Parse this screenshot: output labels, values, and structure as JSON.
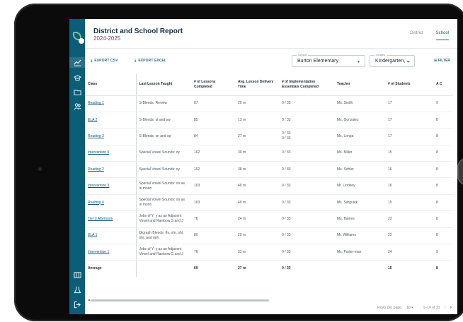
{
  "header": {
    "title": "District and School Report",
    "subtitle": "2024-2025",
    "tabs": [
      {
        "label": "District",
        "active": false
      },
      {
        "label": "School",
        "active": true
      }
    ]
  },
  "toolbar": {
    "export_csv": "EXPORT CSV",
    "export_excel": "EXPORT EXCEL",
    "school": {
      "label": "School",
      "value": "Burton Elementary"
    },
    "grades": {
      "label": "Grades",
      "value": "Kindergarten, ..."
    },
    "filter": "FILTER"
  },
  "table": {
    "columns": [
      "Class",
      "Last Lesson Taught",
      "# of Lessons Completed",
      "Avg. Lesson Delivery Time",
      "# of Implementation Essentials Completed",
      "Teacher",
      "# of Students",
      "A C"
    ],
    "rows": [
      [
        "Reading 1",
        "S-Blends: Review",
        "87",
        "20 m",
        "0 / 33",
        "Ms. Smith",
        "17",
        "9"
      ],
      [
        "ELA 2",
        "S-Blends: st and sw",
        "85",
        "13 m",
        "0 / 33",
        "Ms. Gonzalez",
        "17",
        "8"
      ],
      [
        "Reading 3",
        "S-Blends: sn and sp",
        "84",
        "27 m",
        "0 / 33\n0 / 33",
        "Ms. Longa",
        "17",
        "8"
      ],
      [
        "Intervention 5",
        "Special Vowel Sounds: oy",
        "102",
        "30 m",
        "0 / 33",
        "Ms. Miller",
        "15",
        "8"
      ],
      [
        "Reading 2",
        "Special Vowel Sounds: oy",
        "102",
        "38 m",
        "0 / 33",
        "Ms. Sohler",
        "16",
        "8"
      ],
      [
        "Intervention 3",
        "Special Vowel Sounds: oo as in moon",
        "103",
        "40 m",
        "0 / 33",
        "Mr. Lindsey",
        "16",
        "8"
      ],
      [
        "Reading 4",
        "Special Vowel Sounds: oo as in moon",
        "103",
        "49 m",
        "0 / 33",
        "Ms. Sargulak",
        "15",
        "8"
      ],
      [
        "Tier 3 Afternoon",
        "Jobs of Y: y as an Adjacent Vowel and Rainbow S and J",
        "76",
        "24 m",
        "0 / 33",
        "Ms. Baines",
        "23",
        "8"
      ],
      [
        "ELA 1",
        "Digraph Blends: thr, shr, phl, phr, and nph",
        "80",
        "20 m",
        "0 / 33",
        "Mr. Williams",
        "22",
        "8"
      ],
      [
        "Intervention 1",
        "Jobs of Y: y as an Adjacent Vowel and Rainbow S and J",
        "76",
        "33 m",
        "0 / 33",
        "Ms. Porter-man",
        "24",
        "9"
      ]
    ],
    "average": [
      "Average",
      "",
      "69",
      "27 m",
      "0 / 33",
      "",
      "15",
      "8"
    ]
  },
  "footer": {
    "rows_per_page_label": "Rows per page:",
    "rows_per_page_value": "10",
    "range": "1–10 of 13",
    "prev": "‹",
    "next": "›"
  }
}
